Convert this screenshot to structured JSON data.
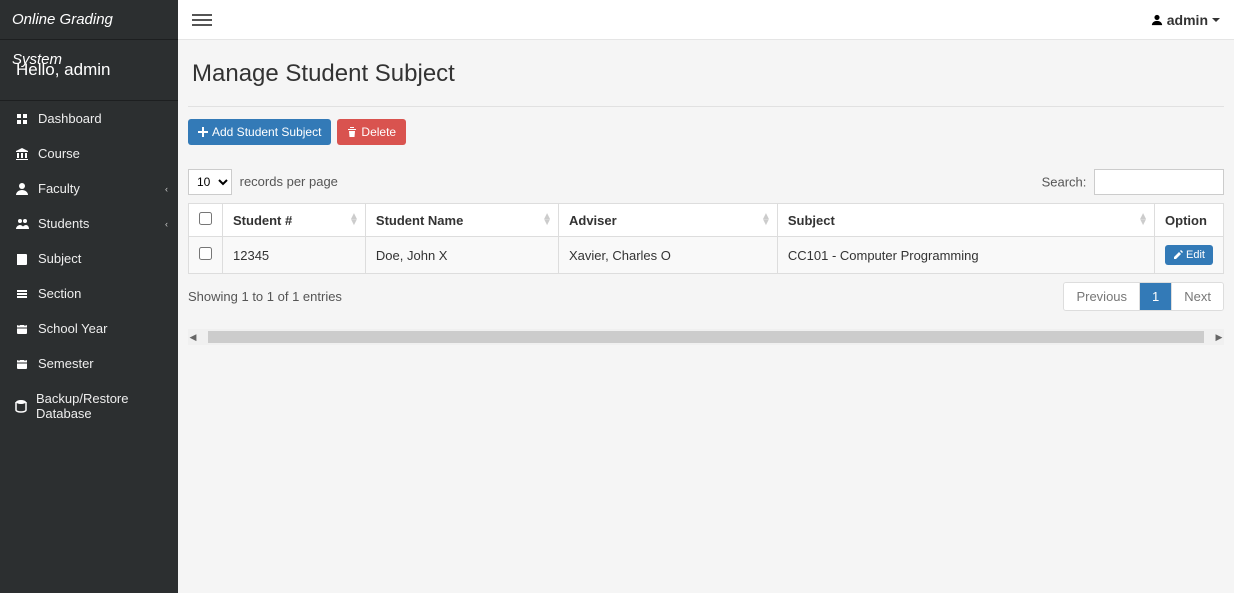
{
  "brand": "Online Grading System",
  "greeting": "Hello, admin",
  "sidebar": {
    "items": [
      {
        "icon": "dashboard-icon",
        "label": "Dashboard",
        "chevron": false
      },
      {
        "icon": "course-icon",
        "label": "Course",
        "chevron": false
      },
      {
        "icon": "faculty-icon",
        "label": "Faculty",
        "chevron": true
      },
      {
        "icon": "students-icon",
        "label": "Students",
        "chevron": true
      },
      {
        "icon": "subject-icon",
        "label": "Subject",
        "chevron": false
      },
      {
        "icon": "section-icon",
        "label": "Section",
        "chevron": false
      },
      {
        "icon": "schoolyear-icon",
        "label": "School Year",
        "chevron": false
      },
      {
        "icon": "semester-icon",
        "label": "Semester",
        "chevron": false
      },
      {
        "icon": "backup-icon",
        "label": "Backup/Restore Database",
        "chevron": false
      }
    ]
  },
  "topbar": {
    "user": "admin"
  },
  "page": {
    "title": "Manage Student Subject",
    "add_label": "Add Student Subject",
    "delete_label": "Delete"
  },
  "datatable": {
    "length_value": "10",
    "length_suffix": "records per page",
    "search_label": "Search:",
    "headers": {
      "student_no": "Student #",
      "student_name": "Student Name",
      "adviser": "Adviser",
      "subject": "Subject",
      "option": "Option"
    },
    "rows": [
      {
        "student_no": "12345",
        "student_name": "Doe, John X",
        "adviser": "Xavier, Charles O",
        "subject": "CC101 - Computer Programming",
        "edit_label": "Edit"
      }
    ],
    "info": "Showing 1 to 1 of 1 entries",
    "pagination": {
      "prev": "Previous",
      "page": "1",
      "next": "Next"
    }
  }
}
